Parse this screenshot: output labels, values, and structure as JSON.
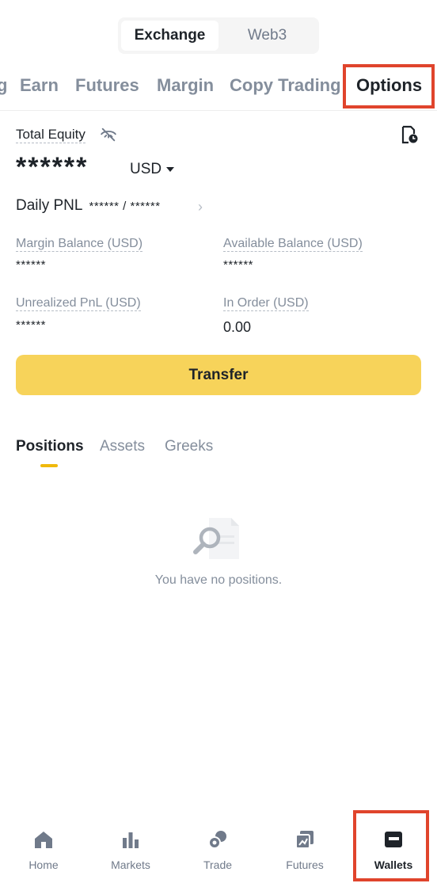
{
  "segmented": {
    "exchange": "Exchange",
    "web3": "Web3"
  },
  "tabs": [
    {
      "label": "g"
    },
    {
      "label": "Earn"
    },
    {
      "label": "Futures"
    },
    {
      "label": "Margin"
    },
    {
      "label": "Copy Trading"
    },
    {
      "label": "Options"
    }
  ],
  "equity": {
    "label": "Total Equity",
    "value": "******",
    "currency": "USD"
  },
  "pnl": {
    "label": "Daily PNL",
    "value": "****** / ******",
    "chevron": "›"
  },
  "fields": {
    "margin_balance": {
      "label": "Margin Balance (USD)",
      "value": "******"
    },
    "available_balance": {
      "label": "Available Balance (USD)",
      "value": "******"
    },
    "unrealized_pnl": {
      "label": "Unrealized PnL (USD)",
      "value": "******"
    },
    "in_order": {
      "label": "In Order (USD)",
      "value": "0.00"
    }
  },
  "transfer_label": "Transfer",
  "subtabs": {
    "positions": "Positions",
    "assets": "Assets",
    "greeks": "Greeks"
  },
  "empty_text": "You have no positions.",
  "bottom_nav": {
    "home": "Home",
    "markets": "Markets",
    "trade": "Trade",
    "futures": "Futures",
    "wallets": "Wallets"
  },
  "colors": {
    "accent_yellow": "#f7d35a",
    "indicator": "#f0b90b",
    "highlight_red": "#e0442c",
    "text_primary": "#1e2329",
    "text_secondary": "#848e9c"
  }
}
